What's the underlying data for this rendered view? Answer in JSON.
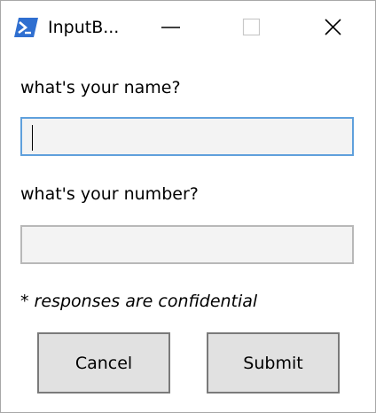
{
  "window": {
    "title": "InputB...",
    "icon": "powershell-icon",
    "controls": {
      "minimize": "minimize-icon",
      "maximize": "maximize-icon",
      "close": "close-icon"
    }
  },
  "form": {
    "name_label": "what's your name?",
    "name_value": "",
    "number_label": "what's your number?",
    "number_value": "",
    "note": "* responses are confidential"
  },
  "buttons": {
    "cancel_label": "Cancel",
    "submit_label": "Submit"
  },
  "colors": {
    "icon_blue": "#2f6fd0",
    "focus_border": "#5fa0dc",
    "field_bg": "#f3f3f3",
    "button_bg": "#e1e1e1"
  }
}
